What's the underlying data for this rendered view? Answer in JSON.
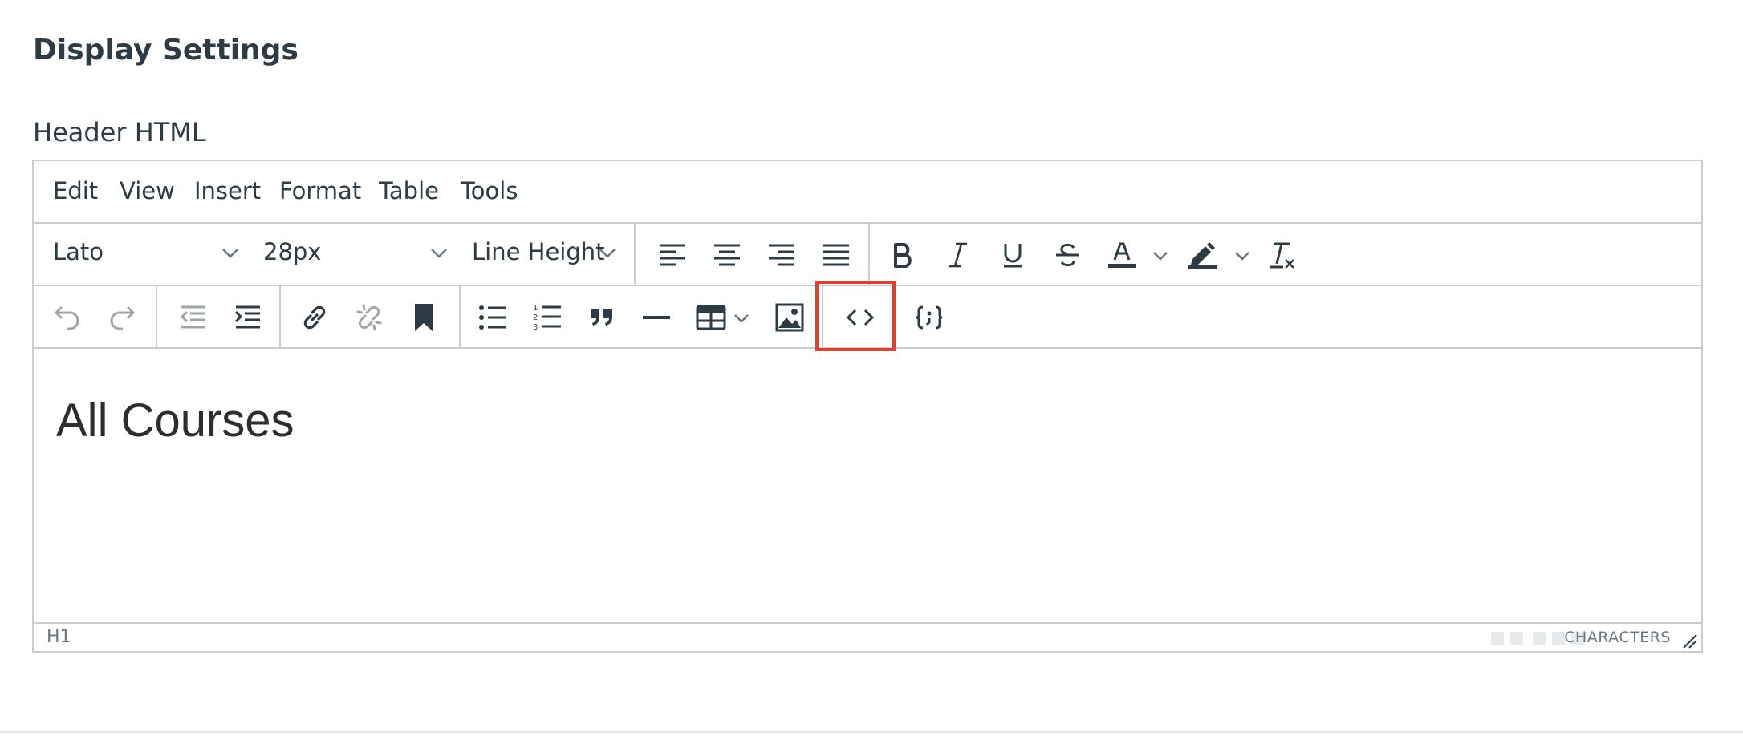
{
  "page": {
    "section_title": "Display Settings",
    "field_label": "Header HTML"
  },
  "menubar": {
    "items": [
      "Edit",
      "View",
      "Insert",
      "Format",
      "Table",
      "Tools"
    ]
  },
  "toolbar": {
    "font_family": "Lato",
    "font_size": "28px",
    "line_height": "Line Height",
    "row1_buttons": [
      "align-left",
      "align-center",
      "align-right",
      "align-justify",
      "bold",
      "italic",
      "underline",
      "strikethrough",
      "text-color",
      "highlight-color",
      "clear-formatting"
    ],
    "row2_buttons": [
      "undo",
      "redo",
      "outdent",
      "indent",
      "link",
      "unlink",
      "bookmark",
      "bullet-list",
      "numbered-list",
      "blockquote",
      "horizontal-rule",
      "table",
      "image",
      "source-code",
      "template-variable"
    ]
  },
  "content": {
    "heading": "All Courses"
  },
  "statusbar": {
    "path": "H1",
    "word_count_label": "CHARACTERS"
  },
  "colors": {
    "highlight": "#e0412c",
    "border": "#c7cdd1",
    "icon": "#2d3b45"
  }
}
